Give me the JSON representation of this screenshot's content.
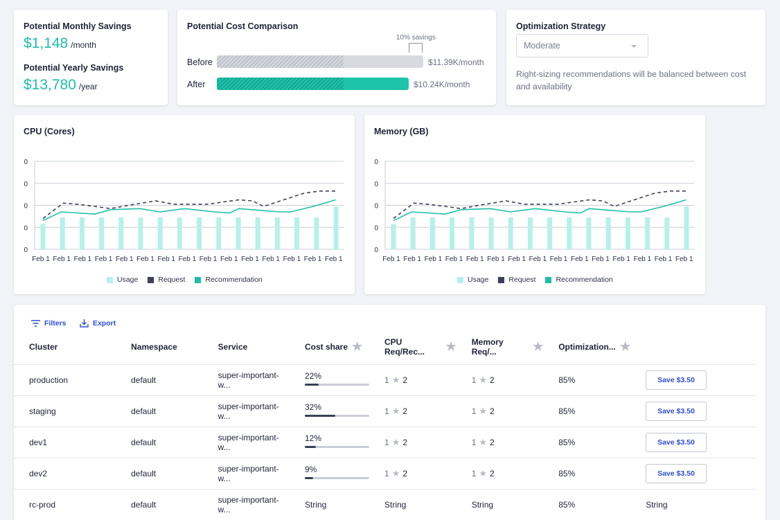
{
  "savings": {
    "monthly_title": "Potential Monthly Savings",
    "monthly_value": "$1,148",
    "monthly_unit": "/month",
    "yearly_title": "Potential Yearly Savings",
    "yearly_value": "$13,780",
    "yearly_unit": "/year"
  },
  "comparison": {
    "title": "Potential Cost Comparison",
    "savings_note": "10% savings",
    "before_label": "Before",
    "before_value": "$11.39K/month",
    "after_label": "After",
    "after_value": "$10.24K/month"
  },
  "strategy": {
    "title": "Optimization Strategy",
    "selected": "Moderate",
    "description": "Right-sizing recommendations will be balanced between cost and availability"
  },
  "colors": {
    "accent": "#1dbfa6",
    "usage": "#b5f1e7",
    "request": "#3d4057",
    "recommendation": "#1dbfa6",
    "link": "#2c4bd8"
  },
  "chart_data": [
    {
      "type": "line",
      "title": "CPU (Cores)",
      "y_tick_labels": [
        "0",
        "0",
        "0",
        "0",
        "0"
      ],
      "x": [
        "Feb 1",
        "Feb 1",
        "Feb 1",
        "Feb 1",
        "Feb 1",
        "Feb 1",
        "Feb 1",
        "Feb 1",
        "Feb 1",
        "Feb 1",
        "Feb 1",
        "Feb 1",
        "Feb 1",
        "Feb 1",
        "Feb 1"
      ],
      "ylim": [
        0,
        4
      ],
      "grid": true,
      "legend_position": "bottom",
      "series": [
        {
          "name": "Usage",
          "type": "bar",
          "values": [
            1.15,
            1.45,
            1.45,
            1.45,
            1.45,
            1.45,
            1.45,
            1.45,
            1.45,
            1.45,
            1.45,
            1.45,
            1.45,
            1.45,
            1.45,
            1.95
          ]
        },
        {
          "name": "Request",
          "type": "line",
          "style": "dashed",
          "points": [
            [
              0,
              1.4
            ],
            [
              0.9,
              2.1
            ],
            [
              1.5,
              2.05
            ],
            [
              2.3,
              1.95
            ],
            [
              3.0,
              1.85
            ],
            [
              3.8,
              2.0
            ],
            [
              5.0,
              2.2
            ],
            [
              5.8,
              2.05
            ],
            [
              7.3,
              2.05
            ],
            [
              8.7,
              2.25
            ],
            [
              9.3,
              2.2
            ],
            [
              9.8,
              1.95
            ],
            [
              11.6,
              2.55
            ],
            [
              12.3,
              2.65
            ],
            [
              13.0,
              2.65
            ]
          ]
        },
        {
          "name": "Recommendation",
          "type": "line",
          "style": "solid",
          "points": [
            [
              0,
              1.3
            ],
            [
              0.8,
              1.7
            ],
            [
              2.3,
              1.6
            ],
            [
              3.0,
              1.8
            ],
            [
              4.3,
              1.85
            ],
            [
              5.2,
              1.7
            ],
            [
              6.3,
              1.85
            ],
            [
              7.6,
              1.7
            ],
            [
              8.3,
              1.65
            ],
            [
              8.7,
              1.85
            ],
            [
              10.5,
              1.7
            ],
            [
              11.0,
              1.7
            ],
            [
              12.0,
              1.95
            ],
            [
              13.0,
              2.25
            ]
          ]
        }
      ]
    },
    {
      "type": "line",
      "title": "Memory (GB)",
      "y_tick_labels": [
        "0",
        "0",
        "0",
        "0",
        "0"
      ],
      "x": [
        "Feb 1",
        "Feb 1",
        "Feb 1",
        "Feb 1",
        "Feb 1",
        "Feb 1",
        "Feb 1",
        "Feb 1",
        "Feb 1",
        "Feb 1",
        "Feb 1",
        "Feb 1",
        "Feb 1",
        "Feb 1",
        "Feb 1"
      ],
      "ylim": [
        0,
        4
      ],
      "grid": true,
      "legend_position": "bottom",
      "series": [
        {
          "name": "Usage",
          "type": "bar",
          "values": [
            1.15,
            1.45,
            1.45,
            1.45,
            1.45,
            1.45,
            1.45,
            1.45,
            1.45,
            1.45,
            1.45,
            1.45,
            1.45,
            1.45,
            1.45,
            1.95
          ]
        },
        {
          "name": "Request",
          "type": "line",
          "style": "dashed",
          "points": [
            [
              0,
              1.4
            ],
            [
              0.9,
              2.1
            ],
            [
              1.5,
              2.05
            ],
            [
              2.3,
              1.95
            ],
            [
              3.0,
              1.85
            ],
            [
              3.8,
              2.0
            ],
            [
              5.0,
              2.2
            ],
            [
              5.8,
              2.05
            ],
            [
              7.3,
              2.05
            ],
            [
              8.7,
              2.25
            ],
            [
              9.3,
              2.2
            ],
            [
              9.8,
              1.95
            ],
            [
              11.6,
              2.55
            ],
            [
              12.3,
              2.65
            ],
            [
              13.0,
              2.65
            ]
          ]
        },
        {
          "name": "Recommendation",
          "type": "line",
          "style": "solid",
          "points": [
            [
              0,
              1.3
            ],
            [
              0.8,
              1.7
            ],
            [
              2.3,
              1.6
            ],
            [
              3.0,
              1.8
            ],
            [
              4.3,
              1.85
            ],
            [
              5.2,
              1.7
            ],
            [
              6.3,
              1.85
            ],
            [
              7.6,
              1.7
            ],
            [
              8.3,
              1.65
            ],
            [
              8.7,
              1.85
            ],
            [
              10.5,
              1.7
            ],
            [
              11.0,
              1.7
            ],
            [
              12.0,
              1.95
            ],
            [
              13.0,
              2.25
            ]
          ]
        }
      ]
    }
  ],
  "toolbar": {
    "filters_label": "Filters",
    "export_label": "Export"
  },
  "table": {
    "columns": [
      "Cluster",
      "Namespace",
      "Service",
      "Cost share",
      "CPU Req/Rec...",
      "Memory Req/...",
      "Optimization..."
    ],
    "rows": [
      {
        "cluster": "production",
        "namespace": "default",
        "service": "super-important-w...",
        "cost_share": "22%",
        "share_fraction": 0.22,
        "cpu_req": "1",
        "cpu_rec": "2",
        "mem_req": "1",
        "mem_rec": "2",
        "optimization": "85%",
        "action": "Save $3.50"
      },
      {
        "cluster": "staging",
        "namespace": "default",
        "service": "super-important-w...",
        "cost_share": "32%",
        "share_fraction": 0.47,
        "cpu_req": "1",
        "cpu_rec": "2",
        "mem_req": "1",
        "mem_rec": "2",
        "optimization": "85%",
        "action": "Save $3.50"
      },
      {
        "cluster": "dev1",
        "namespace": "default",
        "service": "super-important-w...",
        "cost_share": "12%",
        "share_fraction": 0.17,
        "cpu_req": "1",
        "cpu_rec": "2",
        "mem_req": "1",
        "mem_rec": "2",
        "optimization": "85%",
        "action": "Save $3.50"
      },
      {
        "cluster": "dev2",
        "namespace": "default",
        "service": "super-important-w...",
        "cost_share": "9%",
        "share_fraction": 0.13,
        "cpu_req": "1",
        "cpu_rec": "2",
        "mem_req": "1",
        "mem_rec": "2",
        "optimization": "85%",
        "action": "Save $3.50"
      },
      {
        "cluster": "rc-prod",
        "namespace": "default",
        "service": "super-important-w...",
        "cost_share": "String",
        "cpu_text": "String",
        "mem_text": "String",
        "optimization": "85%",
        "action_text": "String"
      }
    ]
  }
}
